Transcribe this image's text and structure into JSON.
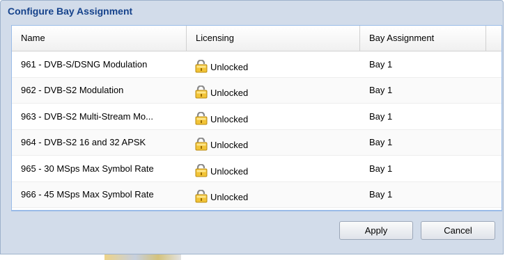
{
  "dialog": {
    "title": "Configure Bay Assignment",
    "columns": [
      "Name",
      "Licensing",
      "Bay Assignment"
    ],
    "rows": [
      {
        "name": "961 - DVB-S/DSNG Modulation",
        "licensing": "Unlocked",
        "bay": "Bay 1"
      },
      {
        "name": "962 - DVB-S2 Modulation",
        "licensing": "Unlocked",
        "bay": "Bay 1"
      },
      {
        "name": "963 - DVB-S2 Multi-Stream Mo...",
        "licensing": "Unlocked",
        "bay": "Bay 1"
      },
      {
        "name": "964 - DVB-S2 16 and 32 APSK",
        "licensing": "Unlocked",
        "bay": "Bay 1"
      },
      {
        "name": "965 - 30 MSps Max Symbol Rate",
        "licensing": "Unlocked",
        "bay": "Bay 1"
      },
      {
        "name": "966 - 45 MSps Max Symbol Rate",
        "licensing": "Unlocked",
        "bay": "Bay 1"
      }
    ],
    "buttons": {
      "apply": "Apply",
      "cancel": "Cancel"
    }
  },
  "icons": {
    "lock": "unlocked-padlock-icon"
  },
  "colors": {
    "title": "#15428b",
    "dialog_bg": "#d2dcea",
    "border": "#99bbe8"
  }
}
